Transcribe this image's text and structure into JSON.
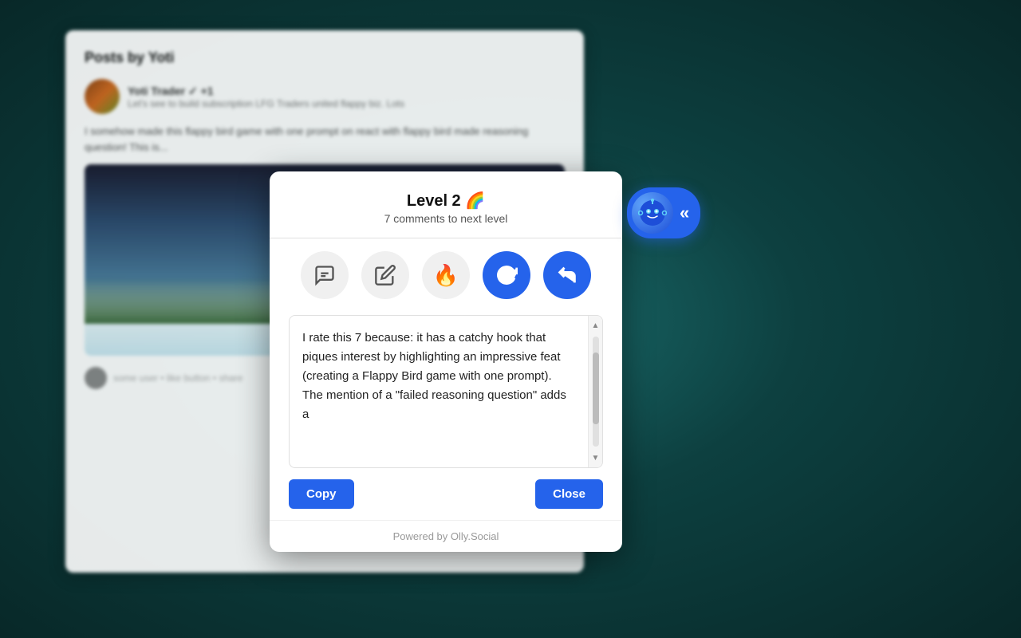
{
  "background": {
    "color_from": "#1a6b6b",
    "color_to": "#082828"
  },
  "bg_card": {
    "title": "Posts by Yoti",
    "post_name": "Yoti Trader ✓ +1",
    "post_sub_text": "Let's see to build subscription LFG Traders united flappy biz. Lots",
    "post_body": "I somehow made this flappy bird game with one prompt on react with flappy bird made reasoning question! This is...",
    "bottom_text": "some user • like button • share"
  },
  "modal": {
    "title": "Level 2 🌈",
    "subtitle": "7 comments to next level",
    "icons": [
      {
        "id": "chat-icon",
        "label": "Chat",
        "active": false
      },
      {
        "id": "edit-icon",
        "label": "Edit",
        "active": false
      },
      {
        "id": "fire-icon",
        "label": "Fire",
        "active": false
      },
      {
        "id": "refresh-icon",
        "label": "Refresh",
        "active": true
      },
      {
        "id": "reply-icon",
        "label": "Reply",
        "active": true
      }
    ],
    "textarea_content": "I rate this 7 because: it has a catchy hook that piques interest by highlighting an impressive feat (creating a Flappy Bird game with one prompt). The mention of a \"failed reasoning question\" adds a",
    "copy_button": "Copy",
    "close_button": "Close",
    "powered_by": "Powered by Olly.Social"
  },
  "bot_button": {
    "chevron": "«"
  }
}
